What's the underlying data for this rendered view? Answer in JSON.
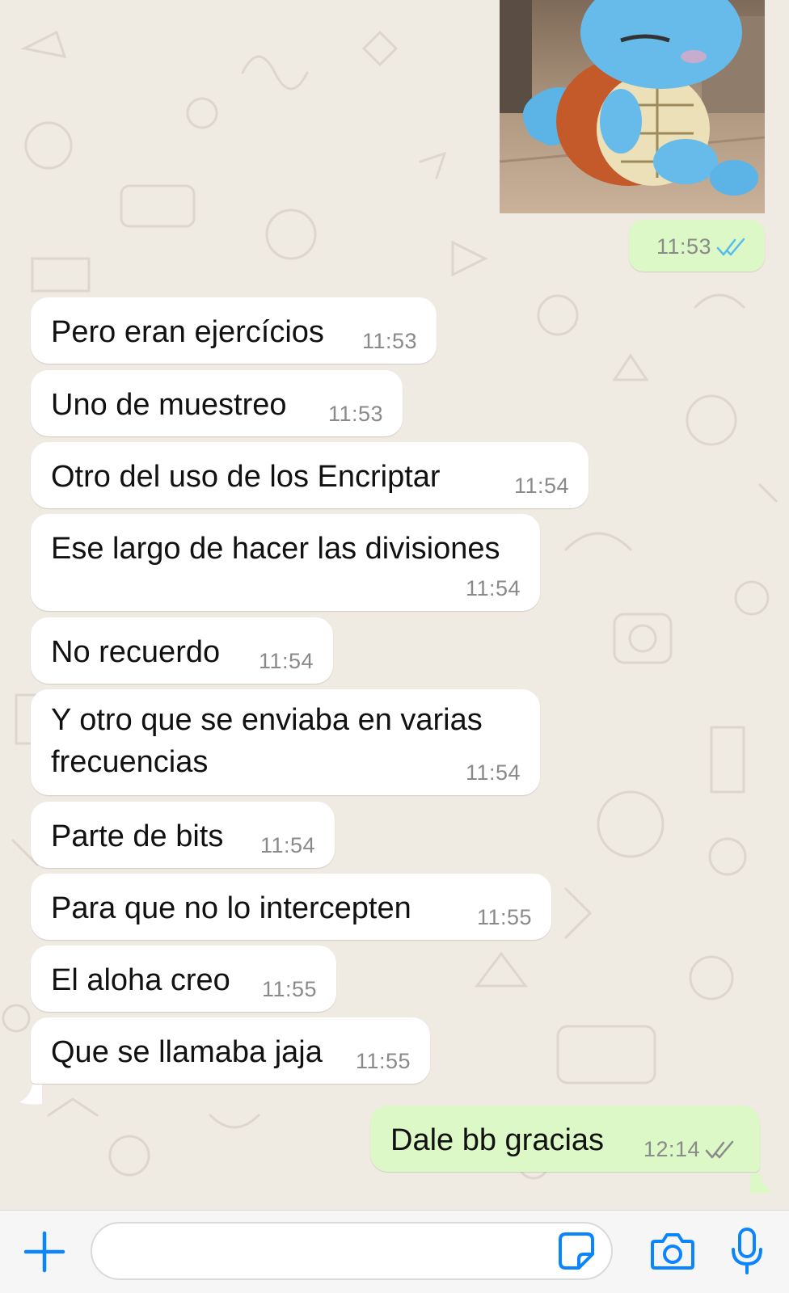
{
  "chat": {
    "image_message": {
      "time": "11:53",
      "status": "read",
      "tick_color": "#53bdeb"
    },
    "messages": [
      {
        "text": "Pero eran ejercícios",
        "time": "11:53"
      },
      {
        "text": "Uno de muestreo",
        "time": "11:53"
      },
      {
        "text": "Otro del uso de los Encriptar",
        "time": "11:54"
      },
      {
        "text": "Ese largo de hacer las divisiones",
        "time": "11:54"
      },
      {
        "text": "No recuerdo",
        "time": "11:54"
      },
      {
        "text": "Y otro que se enviaba en varias",
        "text2": "frecuencias",
        "time": "11:54"
      },
      {
        "text": "Parte de bits",
        "time": "11:54"
      },
      {
        "text": "Para que no lo intercepten",
        "time": "11:55"
      },
      {
        "text": "El aloha creo",
        "time": "11:55"
      },
      {
        "text": "Que se llamaba jaja",
        "time": "11:55"
      }
    ],
    "last_outgoing": {
      "text": "Dale bb gracias",
      "time": "12:14",
      "status": "delivered",
      "tick_color": "#8a8a8a"
    }
  },
  "input_bar": {
    "message_value": "",
    "icons": [
      "plus-icon",
      "sticker-icon",
      "camera-icon",
      "microphone-icon"
    ],
    "accent_color": "#0a84ff"
  },
  "colors": {
    "outgoing_bubble": "#dcf8c6",
    "incoming_bubble": "#ffffff",
    "chat_background": "#efeae2"
  }
}
